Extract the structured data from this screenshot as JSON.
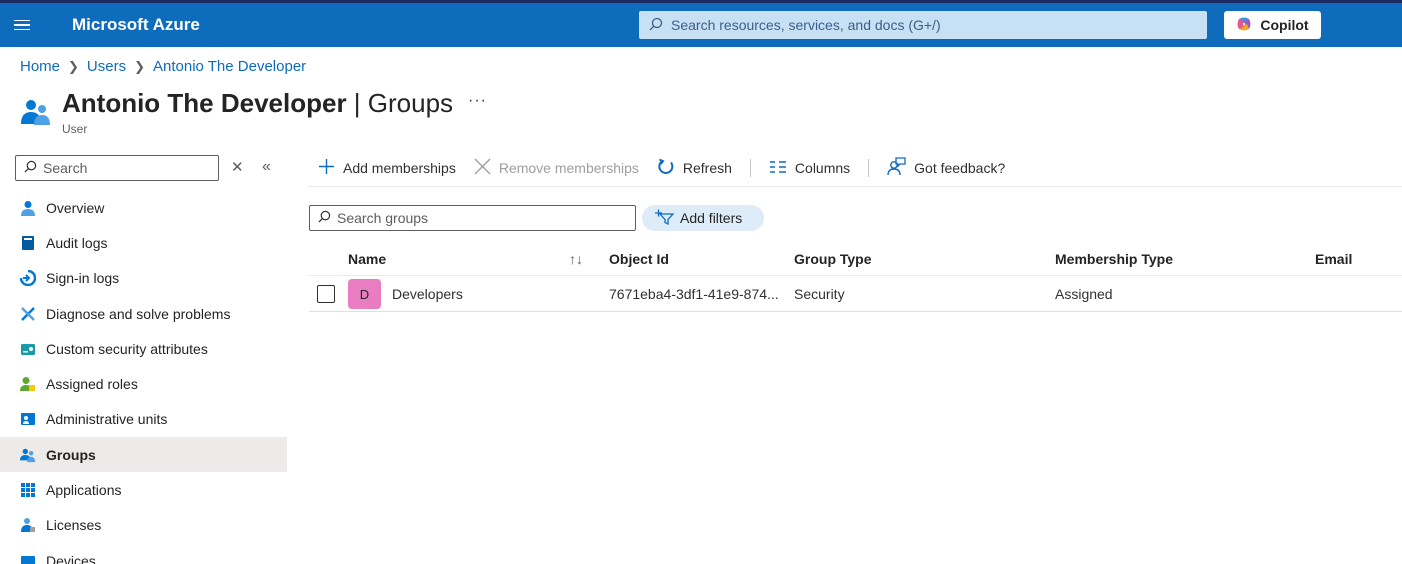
{
  "topbar": {
    "brand": "Microsoft Azure",
    "search_placeholder": "Search resources, services, and docs (G+/)",
    "copilot_label": "Copilot",
    "bg_color": "#0f6cbd"
  },
  "breadcrumb": [
    "Home",
    "Users",
    "Antonio The Developer"
  ],
  "header": {
    "name": "Antonio The Developer",
    "separator": " | ",
    "section": "Groups",
    "more": "···",
    "subtitle": "User"
  },
  "nav": {
    "search_placeholder": "Search",
    "items": [
      {
        "label": "Overview",
        "icon": "person-icon"
      },
      {
        "label": "Audit logs",
        "icon": "book-icon"
      },
      {
        "label": "Sign-in logs",
        "icon": "signin-icon"
      },
      {
        "label": "Diagnose and solve problems",
        "icon": "wrench-icon"
      },
      {
        "label": "Custom security attributes",
        "icon": "tag-icon"
      },
      {
        "label": "Assigned roles",
        "icon": "role-icon"
      },
      {
        "label": "Administrative units",
        "icon": "admin-units-icon"
      },
      {
        "label": "Groups",
        "icon": "groups-icon",
        "active": true
      },
      {
        "label": "Applications",
        "icon": "apps-grid-icon"
      },
      {
        "label": "Licenses",
        "icon": "license-icon"
      },
      {
        "label": "Devices",
        "icon": "device-icon"
      }
    ]
  },
  "toolbar": {
    "add": "Add memberships",
    "remove": "Remove memberships",
    "refresh": "Refresh",
    "columns": "Columns",
    "feedback": "Got feedback?"
  },
  "filters": {
    "search_placeholder": "Search groups",
    "add_filters": "Add filters"
  },
  "table": {
    "columns": [
      "Name",
      "Object Id",
      "Group Type",
      "Membership Type",
      "Email"
    ],
    "sort_indicator": "↑↓",
    "rows": [
      {
        "initial": "D",
        "name": "Developers",
        "object_id": "7671eba4-3df1-41e9-874...",
        "group_type": "Security",
        "membership_type": "Assigned",
        "email": "",
        "avatar_color": "#e87dc1"
      }
    ]
  }
}
